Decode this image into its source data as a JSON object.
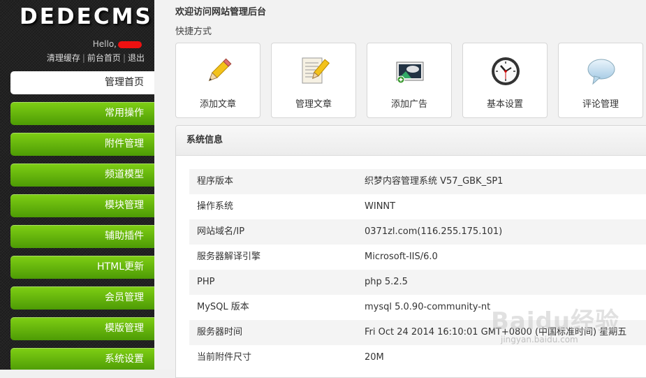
{
  "brand": {
    "logo": "DEDECMS"
  },
  "user": {
    "hello": "Hello,"
  },
  "toplinks": [
    "清理缓存",
    "前台首页",
    "退出"
  ],
  "sidebar": {
    "items": [
      {
        "label": "管理首页",
        "active": true
      },
      {
        "label": "常用操作"
      },
      {
        "label": "附件管理"
      },
      {
        "label": "频道模型"
      },
      {
        "label": "模块管理"
      },
      {
        "label": "辅助插件"
      },
      {
        "label": "HTML更新"
      },
      {
        "label": "会员管理"
      },
      {
        "label": "模版管理"
      },
      {
        "label": "系统设置"
      }
    ]
  },
  "main": {
    "welcome": "欢迎访问网站管理后台",
    "shortcut_title": "快捷方式",
    "shortcuts": [
      {
        "label": "添加文章",
        "icon": "pencil-icon"
      },
      {
        "label": "管理文章",
        "icon": "document-pencil-icon"
      },
      {
        "label": "添加广告",
        "icon": "image-add-icon"
      },
      {
        "label": "基本设置",
        "icon": "clock-icon"
      },
      {
        "label": "评论管理",
        "icon": "speech-bubble-icon"
      }
    ],
    "sysinfo": {
      "title": "系统信息",
      "rows": [
        {
          "key": "程序版本",
          "value": "织梦内容管理系统 V57_GBK_SP1"
        },
        {
          "key": "操作系统",
          "value": "WINNT"
        },
        {
          "key": "网站域名/IP",
          "value": "0371zl.com(116.255.175.101)"
        },
        {
          "key": "服务器解译引擎",
          "value": "Microsoft-IIS/6.0"
        },
        {
          "key": "PHP",
          "value": "php 5.2.5"
        },
        {
          "key": "MySQL 版本",
          "value": "mysql 5.0.90-community-nt"
        },
        {
          "key": "服务器时间",
          "value": "Fri Oct 24 2014 16:10:01 GMT+0800 (中国标准时间) 星期五"
        },
        {
          "key": "当前附件尺寸",
          "value": "20M"
        }
      ]
    }
  },
  "watermark": {
    "big": "Baidu经验",
    "small": "jingyan.baidu.com"
  },
  "colors": {
    "menu_green_top": "#7fcf14",
    "menu_green_bottom": "#4d9b05",
    "sidebar_bg": "#222222"
  }
}
